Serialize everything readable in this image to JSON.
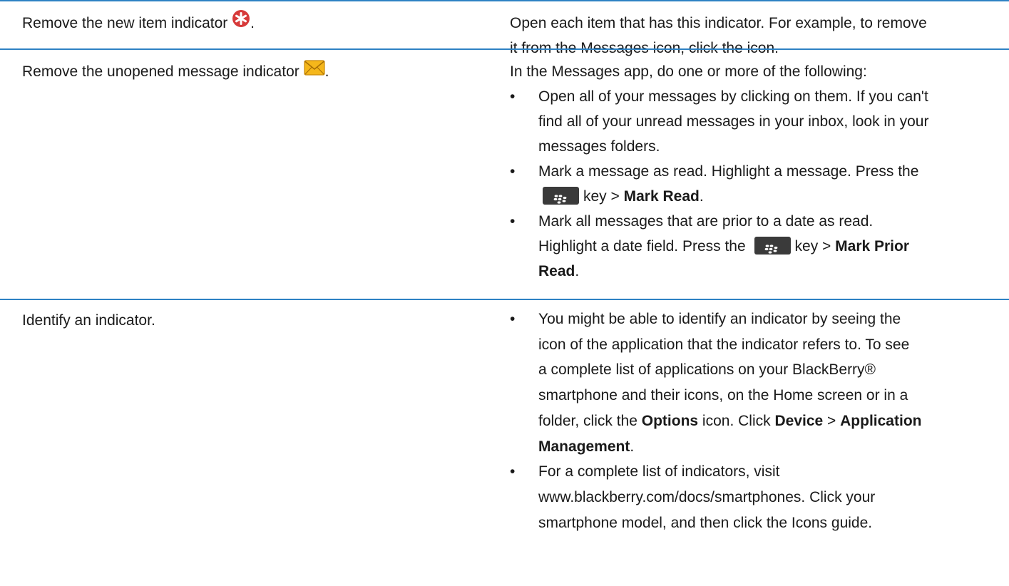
{
  "rows": [
    {
      "task": "Remove the new item indicator",
      "task_end": ".",
      "task_icon": "new-item-indicator-icon",
      "solution_lines": [
        "Open each item that has this indicator. For example, to remove",
        "it from the Messages icon, click the icon."
      ]
    },
    {
      "task": "Remove the unopened message indicator",
      "task_end": ".",
      "task_icon": "unopened-message-icon",
      "intro": "In the Messages app, do one or more of the following:",
      "bullets": [
        {
          "lines": [
            "Open all of your messages by clicking on them. If you can't",
            "find all of your unread messages in your inbox, look in your",
            "messages folders."
          ]
        },
        {
          "line1": "Mark a message as read. Highlight a message. Press the",
          "key_label": "key >",
          "bold": "Mark Read",
          "end": "."
        },
        {
          "line1": "Mark all messages that are prior to a date as read.",
          "line2_pre": "Highlight a date field. Press the",
          "key_label": "key >",
          "bold1": "Mark Prior",
          "bold2": "Read",
          "end": "."
        }
      ]
    },
    {
      "task": "Identify an indicator.",
      "bullets": [
        {
          "lines": [
            "You might be able to identify an indicator by seeing the",
            "icon of the application that the indicator refers to. To see",
            "a complete list of applications on your BlackBerry®",
            "smartphone and their icons, on the Home screen or in a"
          ],
          "l5_pre": "folder, click the",
          "l5_options": "Options",
          "l5_mid": "icon. Click",
          "l5_device": "Device",
          "l5_gt": ">",
          "l5_app": "Application",
          "l6_bold": "Management",
          "l6_end": "."
        },
        {
          "lines": [
            "For a complete list of indicators, visit",
            "www.blackberry.com/docs/smartphones. Click your",
            "smartphone model, and then click the Icons guide."
          ]
        }
      ]
    }
  ],
  "bullet_char": "•",
  "colors": {
    "rule": "#2e82c4",
    "key_bg": "#3a3a3a",
    "new_item": "#d73a3a",
    "envelope": "#f5b71b"
  }
}
